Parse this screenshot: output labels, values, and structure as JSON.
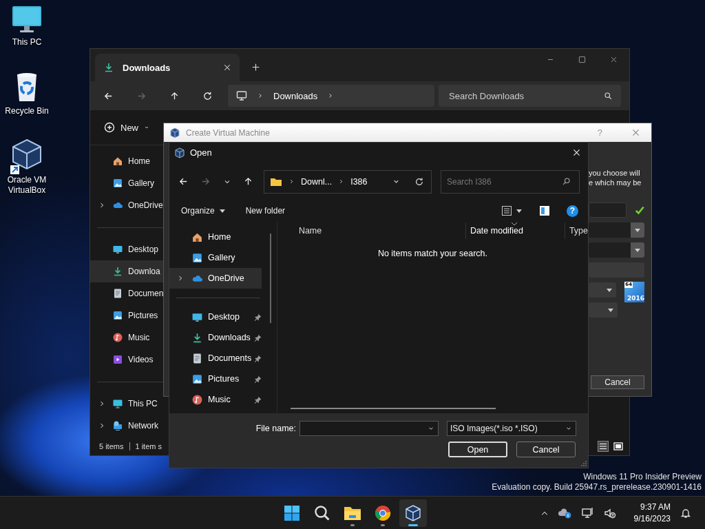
{
  "desktop_icons": [
    {
      "kind": "computer",
      "label": "This PC",
      "shortcut": false
    },
    {
      "kind": "bin",
      "label": "Recycle Bin",
      "shortcut": false
    },
    {
      "kind": "cube",
      "label": "Oracle VM VirtualBox",
      "shortcut": true
    }
  ],
  "explorer": {
    "tabs": [
      {
        "title": "Downloads",
        "selected": true
      }
    ],
    "forward_disabled": true,
    "address": [
      "Downloads"
    ],
    "search": {
      "placeholder": "Search Downloads"
    },
    "new_button": "New",
    "sidebar": [
      {
        "items": [
          {
            "label": "Home",
            "kind": "home",
            "expandable": false,
            "selected": false
          },
          {
            "label": "Gallery",
            "kind": "gallery",
            "expandable": false,
            "selected": false
          },
          {
            "label": "OneDrive",
            "kind": "cloud",
            "expandable": true,
            "selected": false
          }
        ]
      },
      {
        "items": [
          {
            "label": "Desktop",
            "kind": "desktop",
            "expandable": false,
            "selected": false
          },
          {
            "label": "Downloa",
            "kind": "download",
            "expandable": false,
            "selected": true
          },
          {
            "label": "Documen",
            "kind": "document",
            "expandable": false,
            "selected": false
          },
          {
            "label": "Pictures",
            "kind": "picture",
            "expandable": false,
            "selected": false
          },
          {
            "label": "Music",
            "kind": "music",
            "expandable": false,
            "selected": false
          },
          {
            "label": "Videos",
            "kind": "video",
            "expandable": false,
            "selected": false
          }
        ]
      },
      {
        "items": [
          {
            "label": "This PC",
            "kind": "computer",
            "expandable": true,
            "selected": false
          },
          {
            "label": "Network",
            "kind": "network",
            "expandable": true,
            "selected": false
          }
        ]
      }
    ],
    "status": {
      "count": "5 items",
      "selection": "1 item s"
    }
  },
  "create_vm": {
    "title": "Create Virtual Machine",
    "help": "?",
    "description": [
      "you choose will",
      "e which may be"
    ],
    "name_valid": true,
    "fields": [
      {
        "kind": "text"
      },
      {
        "kind": "combo"
      },
      {
        "kind": "combo"
      },
      {
        "kind": "disabled"
      },
      {
        "kind": "short"
      },
      {
        "kind": "short"
      }
    ],
    "os_badge": {
      "bits": "64",
      "version": "2016"
    },
    "cancel": "Cancel"
  },
  "open_dialog": {
    "title": "Open",
    "forward_disabled": true,
    "path": [
      "Downl...",
      "I386"
    ],
    "search": {
      "placeholder": "Search I386"
    },
    "toolbar": {
      "organize": "Organize",
      "new_folder": "New folder",
      "help": "?"
    },
    "nav": [
      {
        "items": [
          {
            "label": "Home",
            "kind": "home",
            "expandable": false,
            "selected": false,
            "pinned": false
          },
          {
            "label": "Gallery",
            "kind": "gallery",
            "expandable": false,
            "selected": false,
            "pinned": false
          },
          {
            "label": "OneDrive",
            "kind": "cloud",
            "expandable": true,
            "selected": true,
            "pinned": false
          }
        ]
      },
      {
        "items": [
          {
            "label": "Desktop",
            "kind": "desktop",
            "expandable": false,
            "selected": false,
            "pinned": true
          },
          {
            "label": "Downloads",
            "kind": "download",
            "expandable": false,
            "selected": false,
            "pinned": true
          },
          {
            "label": "Documents",
            "kind": "document",
            "expandable": false,
            "selected": false,
            "pinned": true
          },
          {
            "label": "Pictures",
            "kind": "picture",
            "expandable": false,
            "selected": false,
            "pinned": true
          },
          {
            "label": "Music",
            "kind": "music",
            "expandable": false,
            "selected": false,
            "pinned": true
          }
        ]
      }
    ],
    "columns": [
      {
        "label": "Name",
        "sorted": false
      },
      {
        "label": "Date modified",
        "sorted": true
      },
      {
        "label": "Type",
        "sorted": false
      }
    ],
    "empty_message": "No items match your search.",
    "file_name_label": "File name:",
    "file_type": "ISO Images(*.iso *.ISO)",
    "buttons": [
      {
        "label": "Open",
        "default": true
      },
      {
        "label": "Cancel",
        "default": false
      }
    ]
  },
  "build_info": [
    "Windows 11 Pro Insider Preview",
    "Evaluation copy. Build 25947.rs_prerelease.230901-1416"
  ],
  "taskbar": {
    "apps": [
      {
        "kind": "start",
        "running": false,
        "active": false
      },
      {
        "kind": "search",
        "running": false,
        "active": false
      },
      {
        "kind": "folder",
        "running": true,
        "active": false
      },
      {
        "kind": "browser",
        "running": true,
        "active": false
      },
      {
        "kind": "cube",
        "running": true,
        "active": true
      }
    ],
    "time": "9:37 AM",
    "date": "9/16/2023"
  }
}
